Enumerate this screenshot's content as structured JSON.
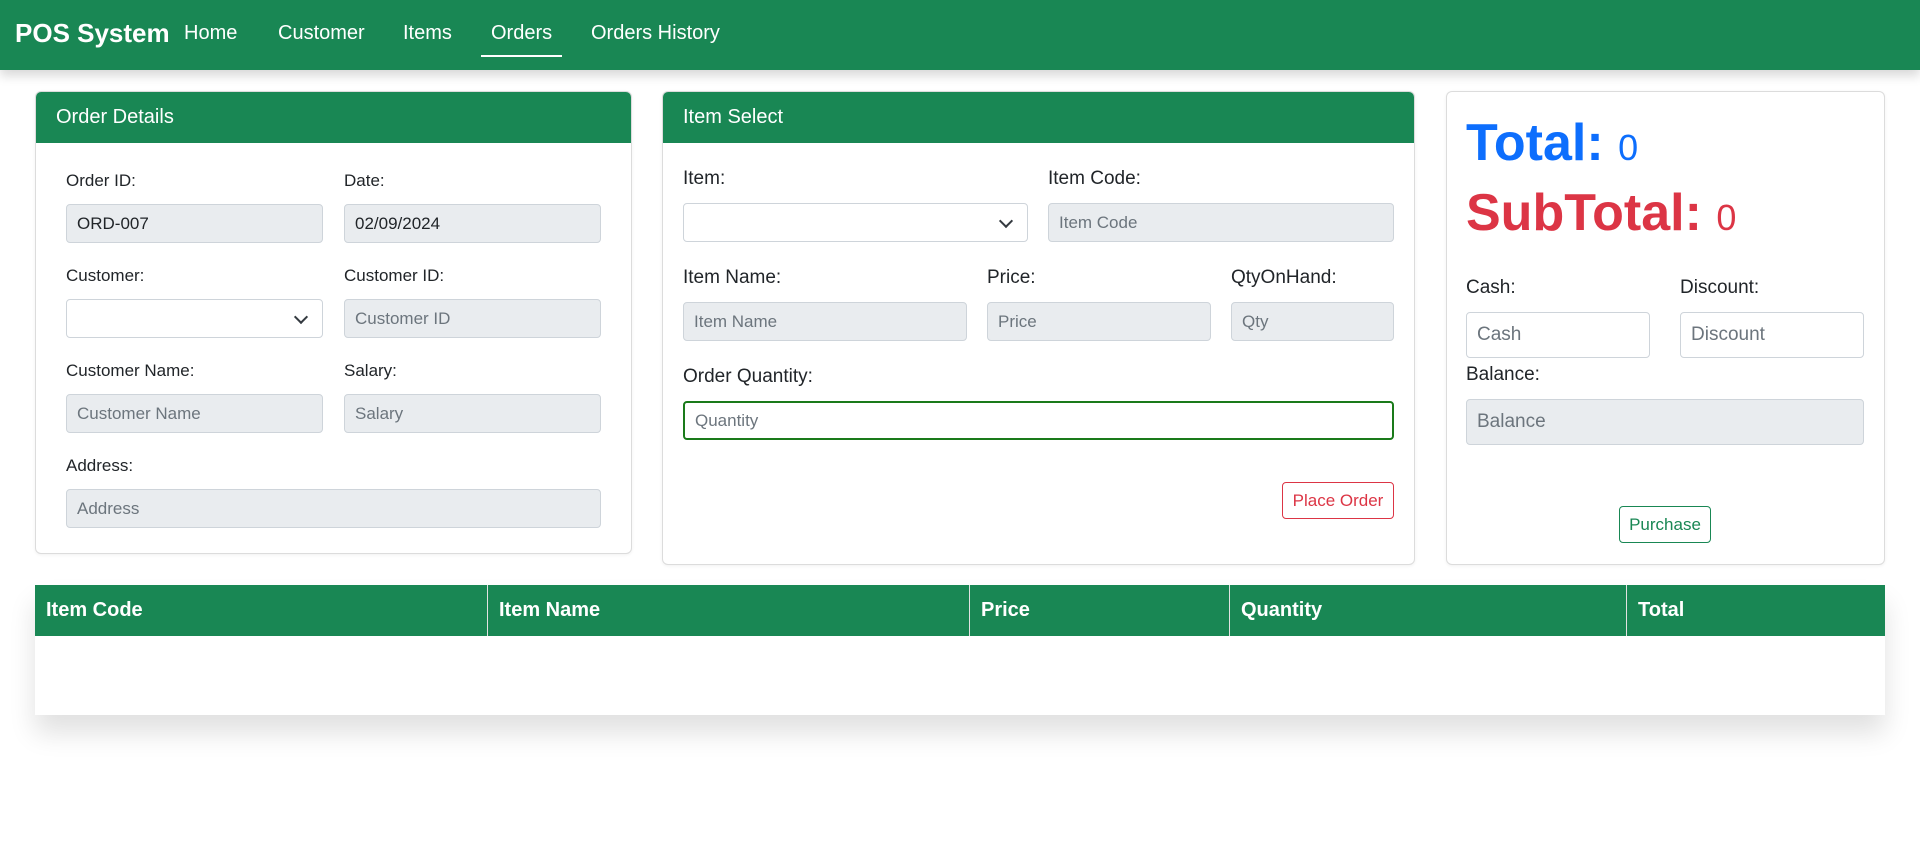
{
  "navbar": {
    "brand": "POS System",
    "links": [
      "Home",
      "Customer",
      "Items",
      "Orders",
      "Orders History"
    ],
    "active": "Orders"
  },
  "order_details": {
    "header": "Order Details",
    "order_id_label": "Order ID:",
    "order_id_value": "ORD-007",
    "date_label": "Date:",
    "date_value": "02/09/2024",
    "customer_label": "Customer:",
    "customer_selected": "",
    "customer_id_label": "Customer ID:",
    "customer_id_placeholder": "Customer ID",
    "customer_name_label": "Customer Name:",
    "customer_name_placeholder": "Customer Name",
    "salary_label": "Salary:",
    "salary_placeholder": "Salary",
    "address_label": "Address:",
    "address_placeholder": "Address"
  },
  "item_select": {
    "header": "Item Select",
    "item_label": "Item:",
    "item_selected": "",
    "item_code_label": "Item Code:",
    "item_code_placeholder": "Item Code",
    "item_name_label": "Item Name:",
    "item_name_placeholder": "Item Name",
    "price_label": "Price:",
    "price_placeholder": "Price",
    "qty_on_hand_label": "QtyOnHand:",
    "qty_on_hand_placeholder": "Qty",
    "order_qty_label": "Order Quantity:",
    "order_qty_placeholder": "Quantity",
    "place_order_label": "Place Order"
  },
  "summary": {
    "total_label": "Total:",
    "total_value": "0",
    "subtotal_label": "SubTotal:",
    "subtotal_value": "0",
    "cash_label": "Cash:",
    "cash_placeholder": "Cash",
    "discount_label": "Discount:",
    "discount_placeholder": "Discount",
    "balance_label": "Balance:",
    "balance_placeholder": "Balance",
    "purchase_label": "Purchase"
  },
  "cart_table": {
    "columns": [
      "Item Code",
      "Item Name",
      "Price",
      "Quantity",
      "Total"
    ],
    "rows": []
  },
  "colors": {
    "primary_green": "#198754",
    "total_blue": "#0d6efd",
    "subtotal_red": "#dc3545"
  }
}
